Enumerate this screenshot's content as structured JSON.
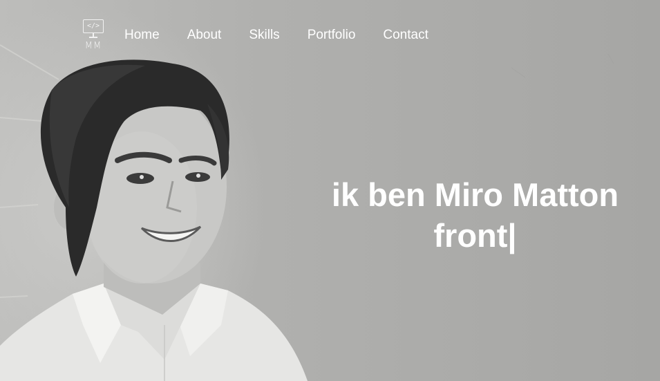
{
  "nav": {
    "logo": {
      "code_glyph": "</>",
      "initials": "MM"
    },
    "links": [
      {
        "label": "Home"
      },
      {
        "label": "About"
      },
      {
        "label": "Skills"
      },
      {
        "label": "Portfolio"
      },
      {
        "label": "Contact"
      }
    ]
  },
  "hero": {
    "intro": "ik ben Miro Matton",
    "typed_text": "front|"
  },
  "colors": {
    "text": "#ffffff",
    "background": "#a9a9a7"
  }
}
